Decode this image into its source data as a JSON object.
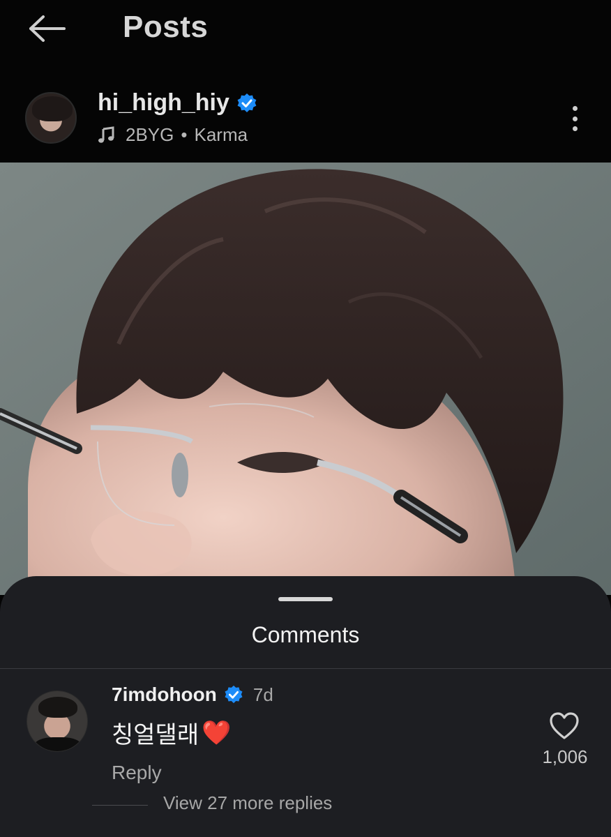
{
  "header": {
    "title": "Posts"
  },
  "post": {
    "username": "hi_high_hiy",
    "music": {
      "artist": "2BYG",
      "separator": "•",
      "song": "Karma"
    }
  },
  "comments_sheet": {
    "title": "Comments",
    "comment": {
      "username": "7imdohoon",
      "time": "7d",
      "text": "칭얼댈래",
      "emoji": "❤️",
      "reply_label": "Reply",
      "like_count": "1,006"
    },
    "view_more_replies": "View 27 more replies"
  },
  "colors": {
    "verified_blue": "#1d8cf8",
    "sheet_bg": "#1d1e22",
    "like_red": "#e0263b"
  },
  "icons": [
    "back-arrow-icon",
    "verified-badge-icon",
    "music-note-icon",
    "more-options-icon",
    "heart-icon"
  ]
}
